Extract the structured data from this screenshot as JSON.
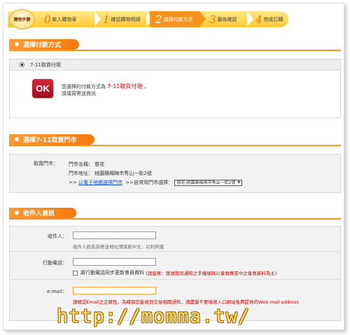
{
  "steps": {
    "badge": "購物步驟",
    "items": [
      {
        "num": "0",
        "label": "款入購物車"
      },
      {
        "num": "1",
        "label": "確認購物明細"
      },
      {
        "num": "2",
        "label": "選擇付款方式"
      },
      {
        "num": "3",
        "label": "最後確認"
      },
      {
        "num": "4",
        "label": "完成訂購"
      }
    ],
    "active_index": 2
  },
  "payment": {
    "section_title": "選擇付款方式",
    "option_label": "7-11取貨付現",
    "ok_logo": "OK",
    "message_prefix": "您選擇的付款方式為",
    "message_method": "7-11取貨付現",
    "message_suffix": "，",
    "message_line2": "請填寫寄送資訊"
  },
  "store": {
    "section_title": "選擇7-11取貨門市",
    "label": "取貨門市：",
    "name_key": "門市名稱：",
    "name_value": "慈花",
    "address_key": "門市地址：",
    "address_value": "桃園縣楊梅市秀山一街2號",
    "map_prefix": ">>",
    "map_link": "以電子地圖選擇門市",
    "common_prefix": ">>自常用門市選擇：",
    "common_selected": "慈花-桃園縣楊梅市秀山一街2號"
  },
  "recipient": {
    "section_title": "收件人資訊",
    "name_label": "收件人：",
    "name_value": "",
    "name_hint": "收件人姓名與寄送地址請填寫中文，以利辨識",
    "phone_label": "行動電話：",
    "phone_value": "",
    "sync_label": "將行動電話同步更新會員資料",
    "sync_warning": "(請留意：發送簡訊通知之手機號碼以會員專區中之會員資料為主)",
    "email_label": "e-mail：",
    "email_value": "",
    "email_warning": "請確認Email之正確性，為確保您能收到交易相關通知，請盡量不要填寫入口網站免費提供的Web mail address"
  },
  "watermark": "http://momma.tw/",
  "colors": {
    "accent": "#f7941d",
    "warning": "#cc0000",
    "link": "#1155cc"
  }
}
